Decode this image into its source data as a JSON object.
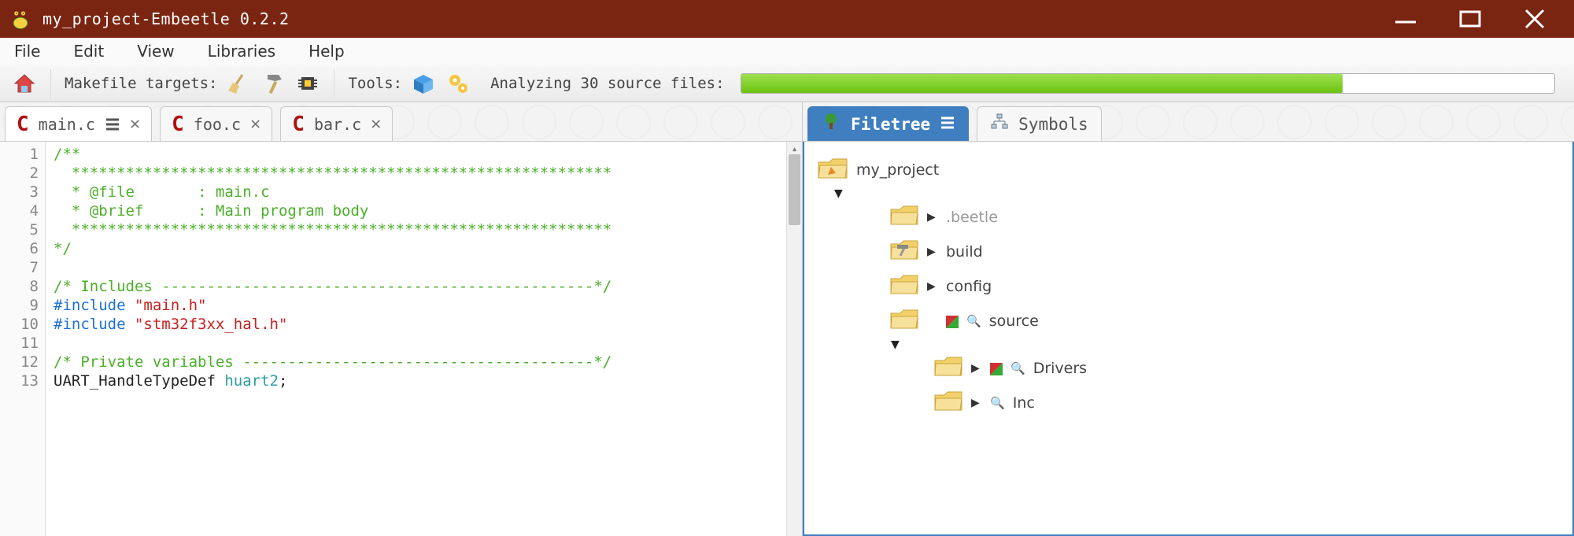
{
  "window": {
    "title": "my_project-Embeetle 0.2.2"
  },
  "menu": {
    "file": "File",
    "edit": "Edit",
    "view": "View",
    "libraries": "Libraries",
    "help": "Help"
  },
  "toolbar": {
    "makefile_label": "Makefile targets:",
    "tools_label": "Tools:",
    "analyze_label": "Analyzing 30 source files:",
    "progress_pct": 74
  },
  "tabs": [
    {
      "label": "main.c",
      "active": true
    },
    {
      "label": "foo.c",
      "active": false
    },
    {
      "label": "bar.c",
      "active": false
    }
  ],
  "right_tabs": {
    "filetree": "Filetree",
    "symbols": "Symbols"
  },
  "code": {
    "lines": [
      {
        "n": 1,
        "seg": [
          {
            "cls": "c-green",
            "t": "/**"
          }
        ]
      },
      {
        "n": 2,
        "seg": [
          {
            "cls": "c-green",
            "t": "  ************************************************************"
          }
        ]
      },
      {
        "n": 3,
        "seg": [
          {
            "cls": "c-green",
            "t": "  * @file       : main.c"
          }
        ]
      },
      {
        "n": 4,
        "seg": [
          {
            "cls": "c-green",
            "t": "  * @brief      : Main program body"
          }
        ]
      },
      {
        "n": 5,
        "seg": [
          {
            "cls": "c-green",
            "t": "  ************************************************************"
          }
        ]
      },
      {
        "n": 6,
        "seg": [
          {
            "cls": "c-green",
            "t": "*/"
          }
        ]
      },
      {
        "n": 7,
        "seg": [
          {
            "cls": "c-black",
            "t": ""
          }
        ]
      },
      {
        "n": 8,
        "seg": [
          {
            "cls": "c-green",
            "t": "/* Includes ------------------------------------------------*/"
          }
        ]
      },
      {
        "n": 9,
        "seg": [
          {
            "cls": "c-blue",
            "t": "#include "
          },
          {
            "cls": "c-red",
            "t": "\"main.h\""
          }
        ]
      },
      {
        "n": 10,
        "seg": [
          {
            "cls": "c-blue",
            "t": "#include "
          },
          {
            "cls": "c-red",
            "t": "\"stm32f3xx_hal.h\""
          }
        ]
      },
      {
        "n": 11,
        "seg": [
          {
            "cls": "c-black",
            "t": ""
          }
        ]
      },
      {
        "n": 12,
        "seg": [
          {
            "cls": "c-green",
            "t": "/* Private variables ---------------------------------------*/"
          }
        ]
      },
      {
        "n": 13,
        "seg": [
          {
            "cls": "c-black",
            "t": "UART_HandleTypeDef "
          },
          {
            "cls": "c-teal",
            "t": "huart2"
          },
          {
            "cls": "c-black",
            "t": ";"
          }
        ]
      }
    ]
  },
  "filetree": {
    "root": "my_project",
    "items": [
      {
        "label": ".beetle",
        "grey": true,
        "depth": 1,
        "icons": []
      },
      {
        "label": "build",
        "grey": false,
        "depth": 1,
        "icons": [
          "hammer"
        ]
      },
      {
        "label": "config",
        "grey": false,
        "depth": 1,
        "icons": []
      },
      {
        "label": "source",
        "grey": false,
        "depth": 1,
        "icons": [
          "rg",
          "mag"
        ],
        "open": true
      },
      {
        "label": "Drivers",
        "grey": false,
        "depth": 2,
        "icons": [
          "rg",
          "mag"
        ]
      },
      {
        "label": "Inc",
        "grey": false,
        "depth": 2,
        "icons": [
          "mag"
        ]
      }
    ]
  }
}
